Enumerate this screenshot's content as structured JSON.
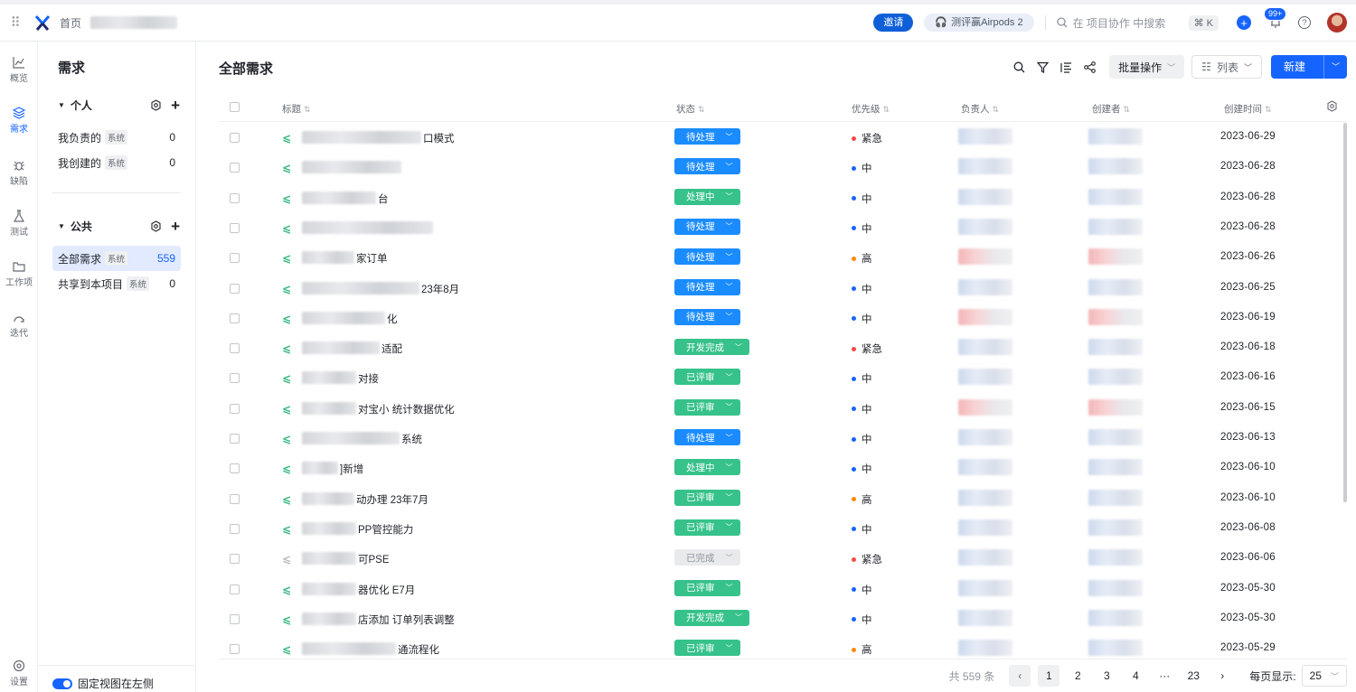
{
  "topbar": {
    "home": "首页",
    "invite": "邀请",
    "promo": "测评赢Airpods 2",
    "search_placeholder": "在 项目协作 中搜索",
    "shortcut": "⌘ K",
    "notif_count": "99+"
  },
  "rail": [
    {
      "label": "概览",
      "icon": "chart-icon"
    },
    {
      "label": "需求",
      "icon": "layers-icon"
    },
    {
      "label": "缺陷",
      "icon": "bug-icon"
    },
    {
      "label": "测试",
      "icon": "flask-icon"
    },
    {
      "label": "工作项",
      "icon": "folder-icon"
    },
    {
      "label": "迭代",
      "icon": "iteration-icon"
    },
    {
      "label": "设置",
      "icon": "settings-icon"
    }
  ],
  "nav": {
    "title": "需求",
    "personal": {
      "label": "个人",
      "items": [
        {
          "label": "我负责的",
          "tag": "系统",
          "count": "0"
        },
        {
          "label": "我创建的",
          "tag": "系统",
          "count": "0"
        }
      ]
    },
    "public": {
      "label": "公共",
      "items": [
        {
          "label": "全部需求",
          "tag": "系统",
          "count": "559"
        },
        {
          "label": "共享到本项目",
          "tag": "系统",
          "count": "0"
        }
      ]
    },
    "pin_label": "固定视图在左侧"
  },
  "main": {
    "title": "全部需求",
    "batch": "批量操作",
    "view": "列表",
    "create": "新建",
    "columns": {
      "title": "标题",
      "status": "状态",
      "priority": "优先级",
      "owner": "负责人",
      "creator": "创建者",
      "created": "创建时间"
    }
  },
  "colors": {
    "pending": "#1a8cff",
    "in_progress": "#36c28a",
    "done_dev": "#36c28a",
    "reviewed": "#36c28a",
    "completed": "#e9eaec",
    "urgent": "#f54a45",
    "mid": "#1664ff",
    "high": "#ff8800"
  },
  "rows": [
    {
      "title_suffix": "口模式",
      "status": "待处理",
      "s": "pending",
      "priority": "紧急",
      "p": "urgent",
      "date": "2023-06-29"
    },
    {
      "title_suffix": "",
      "status": "待处理",
      "s": "pending",
      "priority": "中",
      "p": "mid",
      "date": "2023-06-28"
    },
    {
      "title_suffix": "台",
      "status": "处理中",
      "s": "in_progress",
      "priority": "中",
      "p": "mid",
      "date": "2023-06-28"
    },
    {
      "title_suffix": "",
      "status": "待处理",
      "s": "pending",
      "priority": "中",
      "p": "mid",
      "date": "2023-06-28"
    },
    {
      "title_suffix": "家订单",
      "status": "待处理",
      "s": "pending",
      "priority": "高",
      "p": "high",
      "date": "2023-06-26"
    },
    {
      "title_suffix": "23年8月",
      "status": "待处理",
      "s": "pending",
      "priority": "中",
      "p": "mid",
      "date": "2023-06-25"
    },
    {
      "title_suffix": "化",
      "status": "待处理",
      "s": "pending",
      "priority": "中",
      "p": "mid",
      "date": "2023-06-19"
    },
    {
      "title_suffix": "适配",
      "status": "开发完成",
      "s": "done_dev",
      "priority": "紧急",
      "p": "urgent",
      "date": "2023-06-18"
    },
    {
      "title_suffix": "对接",
      "status": "已评审",
      "s": "reviewed",
      "priority": "中",
      "p": "mid",
      "date": "2023-06-16"
    },
    {
      "title_suffix": "对宝小  统计数据优化",
      "status": "已评审",
      "s": "reviewed",
      "priority": "中",
      "p": "mid",
      "date": "2023-06-15"
    },
    {
      "title_suffix": "系统",
      "status": "待处理",
      "s": "pending",
      "priority": "中",
      "p": "mid",
      "date": "2023-06-13"
    },
    {
      "title_suffix": "]新增",
      "status": "处理中",
      "s": "in_progress",
      "priority": "中",
      "p": "mid",
      "date": "2023-06-10"
    },
    {
      "title_suffix": "动办理  23年7月",
      "status": "已评审",
      "s": "reviewed",
      "priority": "高",
      "p": "high",
      "date": "2023-06-10"
    },
    {
      "title_suffix": "PP管控能力",
      "status": "已评审",
      "s": "reviewed",
      "priority": "中",
      "p": "mid",
      "date": "2023-06-08"
    },
    {
      "title_suffix": "可PSE",
      "status": "已完成",
      "s": "completed",
      "priority": "紧急",
      "p": "urgent",
      "date": "2023-06-06"
    },
    {
      "title_suffix": "器优化  E7月",
      "status": "已评审",
      "s": "reviewed",
      "priority": "中",
      "p": "mid",
      "date": "2023-05-30"
    },
    {
      "title_suffix": "店添加  订单列表调整",
      "status": "开发完成",
      "s": "done_dev",
      "priority": "中",
      "p": "mid",
      "date": "2023-05-30"
    },
    {
      "title_suffix": "通流程化",
      "status": "已评审",
      "s": "reviewed",
      "priority": "高",
      "p": "high",
      "date": "2023-05-29"
    }
  ],
  "pager": {
    "total": "共 559 条",
    "pages": [
      "1",
      "2",
      "3",
      "4",
      "···",
      "23"
    ],
    "per_page_label": "每页显示:",
    "per_page": "25"
  }
}
